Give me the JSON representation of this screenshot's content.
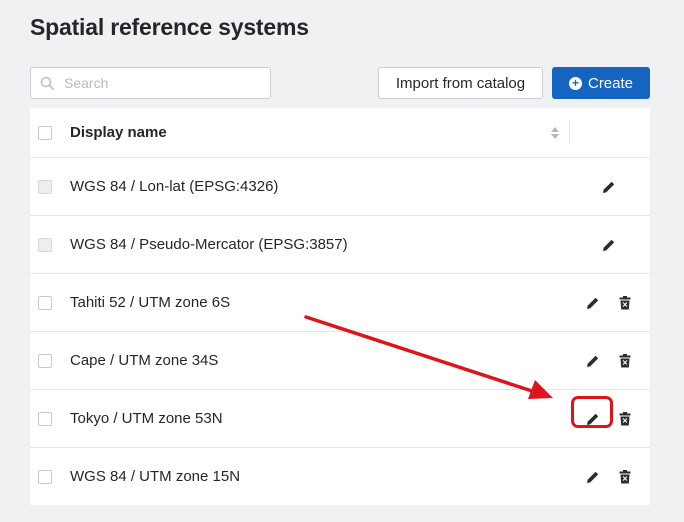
{
  "page": {
    "title": "Spatial reference systems"
  },
  "toolbar": {
    "search_placeholder": "Search",
    "search_value": "",
    "import_label": "Import from catalog",
    "create_label": "Create"
  },
  "table": {
    "header": {
      "display_name": "Display name"
    },
    "rows": [
      {
        "name": "WGS 84 / Lon-lat (EPSG:4326)",
        "checkbox_disabled": true,
        "actions": [
          "edit"
        ]
      },
      {
        "name": "WGS 84 / Pseudo-Mercator (EPSG:3857)",
        "checkbox_disabled": true,
        "actions": [
          "edit"
        ]
      },
      {
        "name": "Tahiti 52 / UTM zone 6S",
        "checkbox_disabled": false,
        "actions": [
          "edit",
          "delete"
        ]
      },
      {
        "name": "Cape / UTM zone 34S",
        "checkbox_disabled": false,
        "actions": [
          "edit",
          "delete"
        ]
      },
      {
        "name": "Tokyo / UTM zone 53N",
        "checkbox_disabled": false,
        "actions": [
          "edit",
          "delete"
        ],
        "highlighted_action": "edit"
      },
      {
        "name": "WGS 84 / UTM zone 15N",
        "checkbox_disabled": false,
        "actions": [
          "edit",
          "delete"
        ]
      }
    ]
  },
  "icons": {
    "search": "search-icon",
    "create": "plus-circle-icon",
    "sort": "sort-icon",
    "edit": "pencil-icon",
    "delete": "trash-icon"
  },
  "colors": {
    "primary": "#1565c0",
    "annotation": "#e0131c",
    "background": "#f0f1f3"
  }
}
